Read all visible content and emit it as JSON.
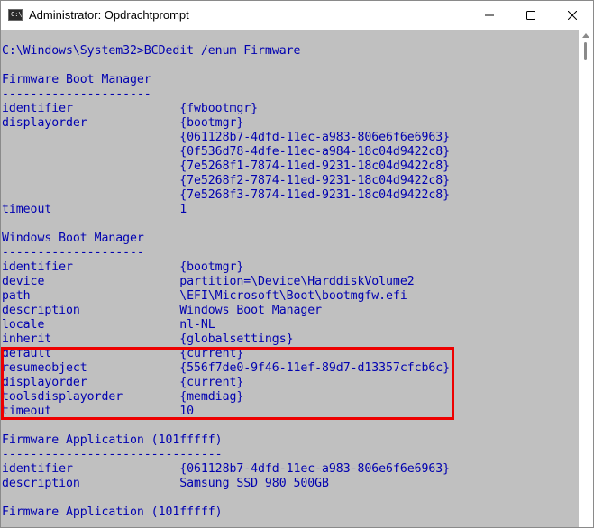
{
  "window": {
    "title": "Administrator: Opdrachtprompt",
    "icon_glyph": "C:\\"
  },
  "console": {
    "lines": [
      "C:\\Windows\\System32>BCDedit /enum Firmware",
      "",
      "Firmware Boot Manager",
      "---------------------",
      "identifier               {fwbootmgr}",
      "displayorder             {bootmgr}",
      "                         {061128b7-4dfd-11ec-a983-806e6f6e6963}",
      "                         {0f536d78-4dfe-11ec-a984-18c04d9422c8}",
      "                         {7e5268f1-7874-11ed-9231-18c04d9422c8}",
      "                         {7e5268f2-7874-11ed-9231-18c04d9422c8}",
      "                         {7e5268f3-7874-11ed-9231-18c04d9422c8}",
      "timeout                  1",
      "",
      "Windows Boot Manager",
      "--------------------",
      "identifier               {bootmgr}",
      "device                   partition=\\Device\\HarddiskVolume2",
      "path                     \\EFI\\Microsoft\\Boot\\bootmgfw.efi",
      "description              Windows Boot Manager",
      "locale                   nl-NL",
      "inherit                  {globalsettings}",
      "default                  {current}",
      "resumeobject             {556f7de0-9f46-11ef-89d7-d13357cfcb6c}",
      "displayorder             {current}",
      "toolsdisplayorder        {memdiag}",
      "timeout                  10",
      "",
      "Firmware Application (101fffff)",
      "-------------------------------",
      "identifier               {061128b7-4dfd-11ec-a983-806e6f6e6963}",
      "description              Samsung SSD 980 500GB",
      "",
      "Firmware Application (101fffff)"
    ]
  },
  "colors": {
    "console_background": "#c0c0c0",
    "console_text": "#0000b0",
    "highlight_border": "#ee0000"
  },
  "icons": [
    "terminal-app-icon",
    "minimize-icon",
    "maximize-icon",
    "close-icon",
    "scroll-up-arrow-icon"
  ]
}
